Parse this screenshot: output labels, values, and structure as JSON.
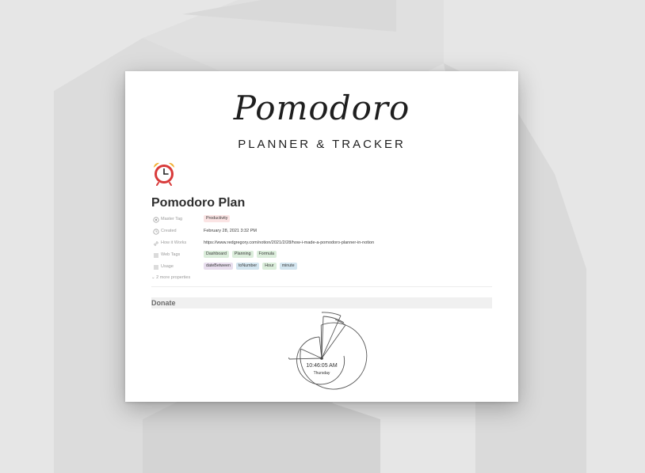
{
  "brand": {
    "script_title": "Pomodoro",
    "subtitle": "PLANNER & TRACKER"
  },
  "page": {
    "icon": "alarm-clock-icon",
    "title": "Pomodoro Plan"
  },
  "properties": [
    {
      "icon": "target-icon",
      "label": "Master Tag",
      "tags": [
        {
          "text": "Productivity",
          "color": "#fbe4e4"
        }
      ]
    },
    {
      "icon": "clock-icon",
      "label": "Created",
      "value": "February 28, 2021 3:32 PM"
    },
    {
      "icon": "link-icon",
      "label": "How it Works",
      "value": "https://www.redgregory.com/notion/2021/2/28/how-i-made-a-pomodoro-planner-in-notion"
    },
    {
      "icon": "list-icon",
      "label": "Web Tags",
      "tags": [
        {
          "text": "Dashboard",
          "color": "#dbeddb"
        },
        {
          "text": "Planning",
          "color": "#dbeddb"
        },
        {
          "text": "Formula",
          "color": "#dbeddb"
        }
      ]
    },
    {
      "icon": "list-icon",
      "label": "Usage",
      "tags": [
        {
          "text": "dateBetween",
          "color": "#e8deee"
        },
        {
          "text": "toNumber",
          "color": "#d3e5ef"
        },
        {
          "text": "Hour",
          "color": "#dbeddb"
        },
        {
          "text": "minute",
          "color": "#d3e5ef"
        }
      ]
    }
  ],
  "more_properties": "2 more properties",
  "section": {
    "title": "Donate"
  },
  "clock": {
    "time": "10:46:05 AM",
    "day": "Thursday"
  }
}
